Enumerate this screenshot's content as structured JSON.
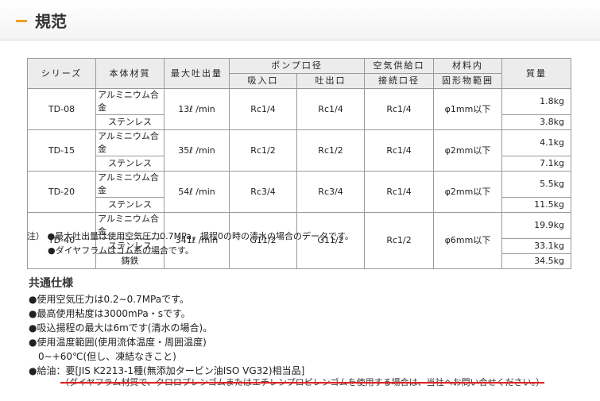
{
  "header": {
    "title": "規范"
  },
  "table": {
    "h_series": "シリーズ",
    "h_body": "本体材質",
    "h_flow": "最大吐出量",
    "h_port": "ポンプ口径",
    "h_inlet": "吸入口",
    "h_outlet": "吐出口",
    "h_air1": "空気供給口",
    "h_air2": "接続口径",
    "h_mat1": "材料内",
    "h_mat2": "固形物範囲",
    "h_weight": "質量",
    "rows": [
      {
        "series": "TD-08",
        "m1": "アルミニウム合金",
        "m2": "ステンレス",
        "flow": "13ℓ /min",
        "in": "Rc1/4",
        "out": "Rc1/4",
        "air": "Rc1/4",
        "solid": "φ1mm以下",
        "w1": "1.8kg",
        "w2": "3.8kg"
      },
      {
        "series": "TD-15",
        "m1": "アルミニウム合金",
        "m2": "ステンレス",
        "flow": "35ℓ /min",
        "in": "Rc1/2",
        "out": "Rc1/2",
        "air": "Rc1/4",
        "solid": "φ2mm以下",
        "w1": "4.1kg",
        "w2": "7.1kg"
      },
      {
        "series": "TD-20",
        "m1": "アルミニウム合金",
        "m2": "ステンレス",
        "flow": "54ℓ /min",
        "in": "Rc3/4",
        "out": "Rc3/4",
        "air": "Rc1/4",
        "solid": "φ2mm以下",
        "w1": "5.5kg",
        "w2": "11.5kg"
      },
      {
        "series": "TD-40",
        "m1": "アルミニウム合金",
        "m2": "ステンレス",
        "m3": "鋳鉄",
        "flow": "341ℓ /min",
        "in": "G11/2",
        "out": "G11/2",
        "air": "Rc1/2",
        "solid": "φ6mm以下",
        "w1": "19.9kg",
        "w2": "33.1kg",
        "w3": "34.5kg"
      }
    ]
  },
  "notes": {
    "prefix": "注）",
    "n1": "●最大吐出量は使用空気圧力0.7MPa、揚程0の時の清水の場合のデータです。",
    "n2": "●ダイヤフラムはゴム系の場合です。"
  },
  "common": {
    "title": "共通仕様",
    "items": [
      "●使用空気圧力は0.2∼0.7MPaです。",
      "●最高使用粘度は3000mPa・sです。",
      "●吸込揚程の最大は6mです(清水の場合)。",
      "●使用温度範囲(使用流体温度・周囲温度)",
      "0∼+60℃(但し、凍結なきこと)",
      "●給油：要[JIS K2213-1種(無添加タービン油ISO VG32)相当品]"
    ],
    "struck": "（ダイヤフラム材質で、クロロプレンゴムまたはエチレンプロピレンゴムを使用する場合は、当社へお問い合せください。）"
  }
}
